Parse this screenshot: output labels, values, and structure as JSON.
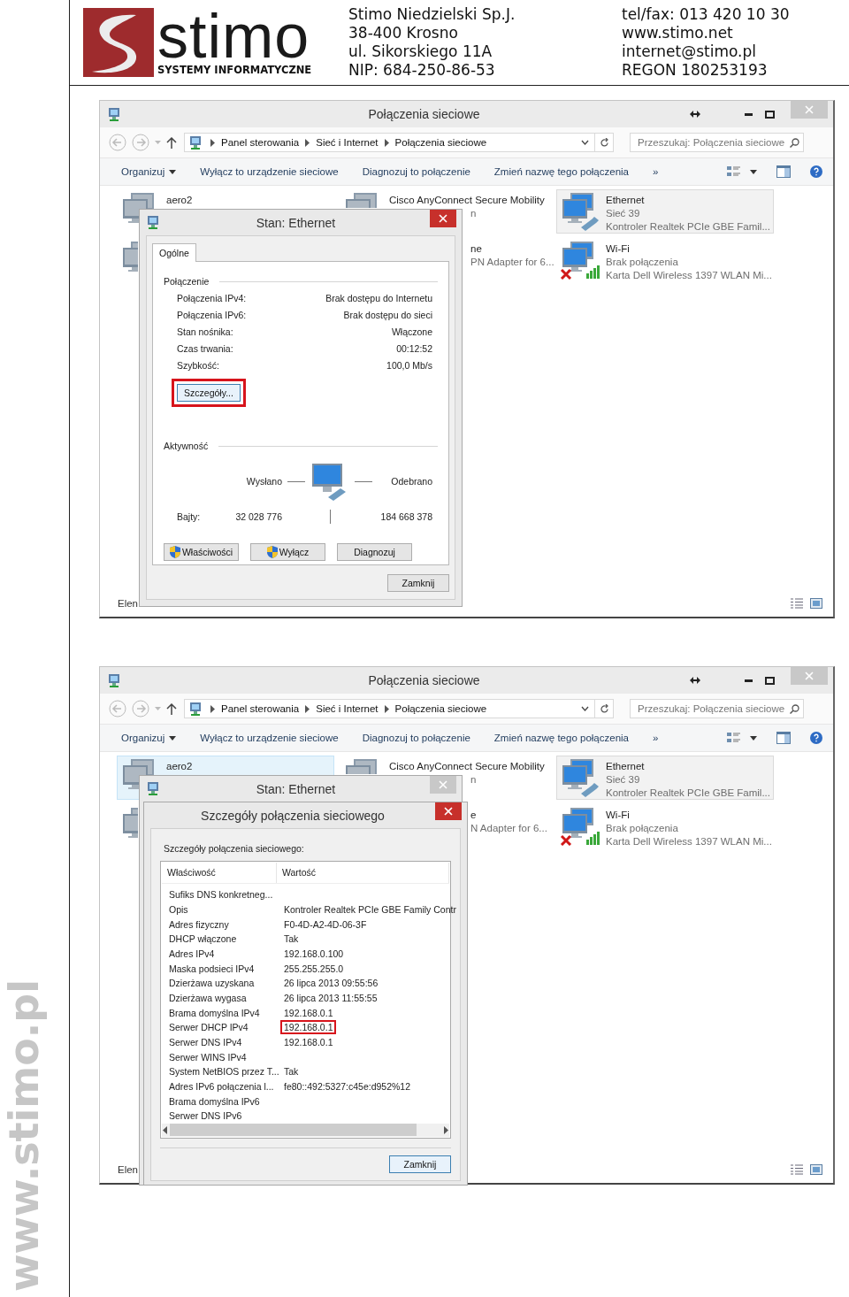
{
  "letterhead": {
    "logo_name": "stimo",
    "logo_tagline": "SYSTEMY INFORMATYCZNE",
    "address": [
      "Stimo Niedzielski Sp.J.",
      "38-400 Krosno",
      "ul. Sikorskiego 11A",
      "NIP: 684-250-86-53"
    ],
    "contact": [
      "tel/fax: 013 420 10 30",
      "www.stimo.net",
      "internet@stimo.pl",
      "REGON 180253193"
    ]
  },
  "side_text": "www.stimo.pl",
  "windows": [
    {
      "title": "Połączenia sieciowe",
      "breadcrumb": [
        "Panel sterowania",
        "Sieć i Internet",
        "Połączenia sieciowe"
      ],
      "search": {
        "placeholder": "Przeszukaj: Połączenia sieciowe"
      },
      "commands": [
        {
          "label": "Organizuj",
          "dropdown": true
        },
        {
          "label": "Wyłącz to urządzenie sieciowe",
          "dropdown": false
        },
        {
          "label": "Diagnozuj to połączenie",
          "dropdown": false
        },
        {
          "label": "Zmień nazwę tego połączenia",
          "dropdown": false
        },
        {
          "label": "»",
          "dropdown": false
        }
      ],
      "connections": [
        {
          "kind": "adapter",
          "selected": false,
          "hovered": false,
          "error": false,
          "lines": [
            "aero2"
          ]
        },
        {
          "kind": "adapter",
          "selected": false,
          "hovered": false,
          "lines": [
            "Cisco AnyConnect Secure Mobility"
          ],
          "fragments": [
            "n"
          ]
        },
        {
          "kind": "wired",
          "selected": true,
          "hovered": false,
          "error": false,
          "lines": [
            "Ethernet",
            "Sieć  39",
            "Kontroler Realtek PCIe GBE Famil..."
          ]
        },
        {
          "kind": "adapter",
          "selected": false,
          "hovered": false,
          "error": false
        },
        {
          "selected": false,
          "hovered": false,
          "fragments": [
            "ne",
            "PN Adapter for 6..."
          ]
        },
        {
          "kind": "wireless",
          "selected": false,
          "hovered": false,
          "error": true,
          "lines": [
            "Wi-Fi",
            "Brak połączenia",
            "Karta Dell Wireless 1397 WLAN Mi..."
          ]
        }
      ],
      "status_bar": "Elen",
      "dialogs": [
        {
          "kind": "status",
          "active": true,
          "title": "Stan: Ethernet",
          "tabs": [
            {
              "label": "Ogólne",
              "selected": true
            }
          ],
          "connection_heading": "Połączenie",
          "fields": [
            {
              "label": "Połączenia IPv4:",
              "value": "Brak dostępu do Internetu"
            },
            {
              "label": "Połączenia IPv6:",
              "value": "Brak dostępu do sieci"
            },
            {
              "label": "Stan nośnika:",
              "value": "Włączone"
            },
            {
              "label": "Czas trwania:",
              "value": "00:12:52"
            },
            {
              "label": "Szybkość:",
              "value": "100,0 Mb/s"
            }
          ],
          "details_button": {
            "label": "Szczegóły...",
            "highlighted": true
          },
          "activity_heading": "Aktywność",
          "sent_label": "Wysłano",
          "received_label": "Odebrano",
          "bytes_label": "Bajty:",
          "bytes_sent": "32 028 776",
          "bytes_received": "184 668 378",
          "buttons": [
            {
              "label": "Właściwości",
              "shield": true
            },
            {
              "label": "Wyłącz",
              "shield": true
            },
            {
              "label": "Diagnozuj",
              "shield": false
            }
          ],
          "close_button": "Zamknij"
        }
      ]
    },
    {
      "title": "Połączenia sieciowe",
      "breadcrumb": [
        "Panel sterowania",
        "Sieć i Internet",
        "Połączenia sieciowe"
      ],
      "search": {
        "placeholder": "Przeszukaj: Połączenia sieciowe"
      },
      "commands": [
        {
          "label": "Organizuj",
          "dropdown": true
        },
        {
          "label": "Wyłącz to urządzenie sieciowe",
          "dropdown": false
        },
        {
          "label": "Diagnozuj to połączenie",
          "dropdown": false
        },
        {
          "label": "Zmień nazwę tego połączenia",
          "dropdown": false
        },
        {
          "label": "»",
          "dropdown": false
        }
      ],
      "connections": [
        {
          "kind": "adapter",
          "selected": false,
          "hovered": true,
          "error": false,
          "lines": [
            "aero2"
          ]
        },
        {
          "kind": "adapter",
          "selected": false,
          "hovered": false,
          "lines": [
            "Cisco AnyConnect Secure Mobility"
          ],
          "fragments": [
            "n"
          ]
        },
        {
          "kind": "wired",
          "selected": true,
          "hovered": false,
          "error": false,
          "lines": [
            "Ethernet",
            "Sieć  39",
            "Kontroler Realtek PCIe GBE Famil..."
          ]
        },
        {
          "kind": "adapter",
          "selected": false,
          "hovered": false,
          "error": false
        },
        {
          "selected": false,
          "hovered": false,
          "fragments": [
            "e",
            "N Adapter for 6..."
          ]
        },
        {
          "kind": "wireless",
          "selected": false,
          "hovered": false,
          "error": true,
          "lines": [
            "Wi-Fi",
            "Brak połączenia",
            "Karta Dell Wireless 1397 WLAN Mi..."
          ]
        }
      ],
      "status_bar": "Elen",
      "dialogs": [
        {
          "kind": "status",
          "active": false,
          "title": "Stan: Ethernet"
        },
        {
          "kind": "details",
          "active": true,
          "title": "Szczegóły połączenia sieciowego",
          "caption": "Szczegóły połączenia sieciowego:",
          "columns": [
            "Właściwość",
            "Wartość"
          ],
          "rows": [
            {
              "property": "Sufiks DNS konkretneg...",
              "highlighted": false
            },
            {
              "property": "Opis",
              "value": "Kontroler Realtek PCIe GBE Family Contr",
              "highlighted": false
            },
            {
              "property": "Adres fizyczny",
              "value": "F0-4D-A2-4D-06-3F",
              "highlighted": false
            },
            {
              "property": "DHCP włączone",
              "value": "Tak",
              "highlighted": false
            },
            {
              "property": "Adres IPv4",
              "value": "192.168.0.100",
              "highlighted": false
            },
            {
              "property": "Maska podsieci IPv4",
              "value": "255.255.255.0",
              "highlighted": false
            },
            {
              "property": "Dzierżawa uzyskana",
              "value": "26 lipca 2013 09:55:56",
              "highlighted": false
            },
            {
              "property": "Dzierżawa wygasa",
              "value": "26 lipca 2013 11:55:55",
              "highlighted": false
            },
            {
              "property": "Brama domyślna IPv4",
              "value": "192.168.0.1",
              "highlighted": false
            },
            {
              "property": "Serwer DHCP IPv4",
              "value": "192.168.0.1",
              "highlighted": true
            },
            {
              "property": "Serwer DNS IPv4",
              "value": "192.168.0.1",
              "highlighted": false
            },
            {
              "property": "Serwer WINS IPv4",
              "highlighted": false
            },
            {
              "property": "System NetBIOS przez T...",
              "value": "Tak",
              "highlighted": false
            },
            {
              "property": "Adres IPv6 połączenia l...",
              "value": "fe80::492:5327:c45e:d952%12",
              "highlighted": false
            },
            {
              "property": "Brama domyślna IPv6",
              "highlighted": false
            },
            {
              "property": "Serwer DNS IPv6",
              "highlighted": false
            }
          ],
          "close_button": "Zamknij"
        }
      ]
    }
  ]
}
